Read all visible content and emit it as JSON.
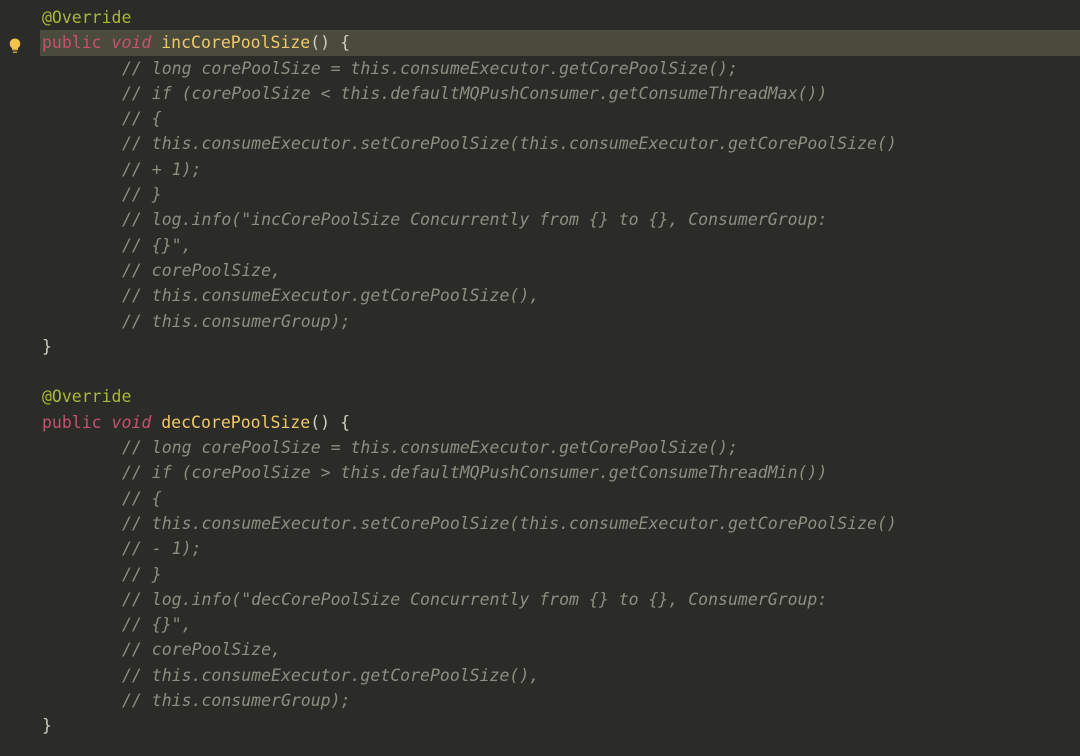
{
  "icons": {
    "bulb": "lightbulb-icon"
  },
  "code": {
    "lines": [
      {
        "indent": 0,
        "hl": false,
        "segments": [
          {
            "cls": "c-annotation",
            "t": "@Override"
          }
        ]
      },
      {
        "indent": 0,
        "hl": true,
        "segments": [
          {
            "cls": "c-keyword",
            "t": "public"
          },
          {
            "cls": "",
            "t": " "
          },
          {
            "cls": "c-type",
            "t": "void"
          },
          {
            "cls": "",
            "t": " "
          },
          {
            "cls": "c-method",
            "t": "incCorePoolSize"
          },
          {
            "cls": "c-paren",
            "t": "()"
          },
          {
            "cls": "",
            "t": " "
          },
          {
            "cls": "c-brace",
            "t": "{"
          }
        ]
      },
      {
        "indent": 2,
        "hl": false,
        "segments": [
          {
            "cls": "c-comment",
            "t": "// long corePoolSize = this.consumeExecutor.getCorePoolSize();"
          }
        ]
      },
      {
        "indent": 2,
        "hl": false,
        "segments": [
          {
            "cls": "c-comment",
            "t": "// if (corePoolSize < this.defaultMQPushConsumer.getConsumeThreadMax())"
          }
        ]
      },
      {
        "indent": 2,
        "hl": false,
        "segments": [
          {
            "cls": "c-comment",
            "t": "// {"
          }
        ]
      },
      {
        "indent": 2,
        "hl": false,
        "segments": [
          {
            "cls": "c-comment",
            "t": "// this.consumeExecutor.setCorePoolSize(this.consumeExecutor.getCorePoolSize()"
          }
        ]
      },
      {
        "indent": 2,
        "hl": false,
        "segments": [
          {
            "cls": "c-comment",
            "t": "// + 1);"
          }
        ]
      },
      {
        "indent": 2,
        "hl": false,
        "segments": [
          {
            "cls": "c-comment",
            "t": "// }"
          }
        ]
      },
      {
        "indent": 2,
        "hl": false,
        "segments": [
          {
            "cls": "c-comment",
            "t": "// log.info(\"incCorePoolSize Concurrently from {} to {}, ConsumerGroup:"
          }
        ]
      },
      {
        "indent": 2,
        "hl": false,
        "segments": [
          {
            "cls": "c-comment",
            "t": "// {}\","
          }
        ]
      },
      {
        "indent": 2,
        "hl": false,
        "segments": [
          {
            "cls": "c-comment",
            "t": "// corePoolSize,"
          }
        ]
      },
      {
        "indent": 2,
        "hl": false,
        "segments": [
          {
            "cls": "c-comment",
            "t": "// this.consumeExecutor.getCorePoolSize(),"
          }
        ]
      },
      {
        "indent": 2,
        "hl": false,
        "segments": [
          {
            "cls": "c-comment",
            "t": "// this.consumerGroup);"
          }
        ]
      },
      {
        "indent": 0,
        "hl": false,
        "segments": [
          {
            "cls": "c-brace",
            "t": "}"
          }
        ]
      },
      {
        "indent": 0,
        "hl": false,
        "segments": [
          {
            "cls": "",
            "t": ""
          }
        ]
      },
      {
        "indent": 0,
        "hl": false,
        "segments": [
          {
            "cls": "c-annotation",
            "t": "@Override"
          }
        ]
      },
      {
        "indent": 0,
        "hl": false,
        "segments": [
          {
            "cls": "c-keyword",
            "t": "public"
          },
          {
            "cls": "",
            "t": " "
          },
          {
            "cls": "c-type",
            "t": "void"
          },
          {
            "cls": "",
            "t": " "
          },
          {
            "cls": "c-method",
            "t": "decCorePoolSize"
          },
          {
            "cls": "c-paren",
            "t": "()"
          },
          {
            "cls": "",
            "t": " "
          },
          {
            "cls": "c-brace",
            "t": "{"
          }
        ]
      },
      {
        "indent": 2,
        "hl": false,
        "segments": [
          {
            "cls": "c-comment",
            "t": "// long corePoolSize = this.consumeExecutor.getCorePoolSize();"
          }
        ]
      },
      {
        "indent": 2,
        "hl": false,
        "segments": [
          {
            "cls": "c-comment",
            "t": "// if (corePoolSize > this.defaultMQPushConsumer.getConsumeThreadMin())"
          }
        ]
      },
      {
        "indent": 2,
        "hl": false,
        "segments": [
          {
            "cls": "c-comment",
            "t": "// {"
          }
        ]
      },
      {
        "indent": 2,
        "hl": false,
        "segments": [
          {
            "cls": "c-comment",
            "t": "// this.consumeExecutor.setCorePoolSize(this.consumeExecutor.getCorePoolSize()"
          }
        ]
      },
      {
        "indent": 2,
        "hl": false,
        "segments": [
          {
            "cls": "c-comment",
            "t": "// - 1);"
          }
        ]
      },
      {
        "indent": 2,
        "hl": false,
        "segments": [
          {
            "cls": "c-comment",
            "t": "// }"
          }
        ]
      },
      {
        "indent": 2,
        "hl": false,
        "segments": [
          {
            "cls": "c-comment",
            "t": "// log.info(\"decCorePoolSize Concurrently from {} to {}, ConsumerGroup:"
          }
        ]
      },
      {
        "indent": 2,
        "hl": false,
        "segments": [
          {
            "cls": "c-comment",
            "t": "// {}\","
          }
        ]
      },
      {
        "indent": 2,
        "hl": false,
        "segments": [
          {
            "cls": "c-comment",
            "t": "// corePoolSize,"
          }
        ]
      },
      {
        "indent": 2,
        "hl": false,
        "segments": [
          {
            "cls": "c-comment",
            "t": "// this.consumeExecutor.getCorePoolSize(),"
          }
        ]
      },
      {
        "indent": 2,
        "hl": false,
        "segments": [
          {
            "cls": "c-comment",
            "t": "// this.consumerGroup);"
          }
        ]
      },
      {
        "indent": 0,
        "hl": false,
        "segments": [
          {
            "cls": "c-brace",
            "t": "}"
          }
        ]
      }
    ]
  }
}
